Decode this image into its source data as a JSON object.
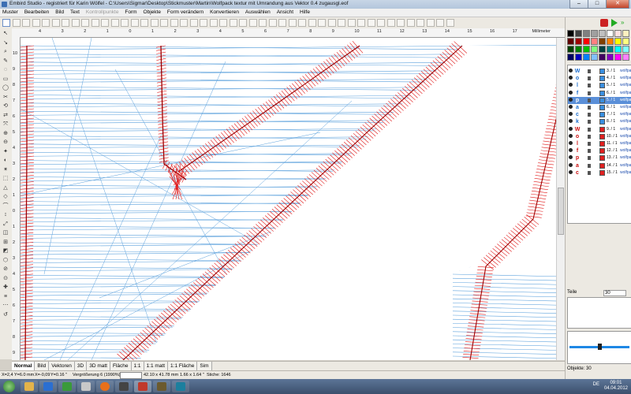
{
  "window": {
    "title": "Embird Studio - registriert für Karin Wölfel - C:\\Users\\Sigmar\\Desktop\\Stickmuster\\Martin\\Wolfpack textur mit Umrandung aus Vektor 0.4 zugausgl.eof",
    "minimize": "–",
    "maximize": "□",
    "close": "✕"
  },
  "menu": {
    "items": [
      "Muster",
      "Bearbeiten",
      "Bild",
      "Text",
      "Kontrollpunkte",
      "Form",
      "Objekte",
      "Form verändern",
      "Konvertieren",
      "Auswählen",
      "Ansicht",
      "Hilfe"
    ],
    "disabled_index": 4
  },
  "ruler": {
    "unit": "Millimeter",
    "h_labels": [
      "4",
      "3",
      "2",
      "1",
      "0",
      "1",
      "2",
      "3",
      "4",
      "5",
      "6",
      "7",
      "8",
      "9",
      "10",
      "11",
      "12",
      "13",
      "14",
      "15",
      "16",
      "17"
    ],
    "v_labels": [
      "10",
      "9",
      "8",
      "7",
      "6",
      "5",
      "4",
      "3",
      "2",
      "1",
      "0",
      "1",
      "2",
      "3",
      "4",
      "5",
      "6",
      "7",
      "8",
      "9"
    ]
  },
  "tabs": {
    "items": [
      "Normal",
      "Bild",
      "Vektoren",
      "3D",
      "3D matt",
      "Fläche",
      "1:1",
      "1:1 matt",
      "1:1 Fläche",
      "Sim"
    ],
    "active_index": 0
  },
  "status": {
    "x1": "X=2,4",
    "y1": "Y=6.0 mm",
    "x2": "X=-0,09",
    "y2": "Y=0.16 \"",
    "zoom": "Vergrößerung 6 (1990%)",
    "size_mm": "42.10 x 41.78 mm",
    "size_in": "1.66 x 1.64 \"",
    "stiche": "Stiche: 1646"
  },
  "right_panel": {
    "teile_label": "Teile",
    "teile_value": "30",
    "objekte": "Objekte: 30",
    "palette_colors": [
      "#000000",
      "#404040",
      "#808080",
      "#a0a0a0",
      "#c0c0c0",
      "#ffffff",
      "#ffe0e0",
      "#fff0c0",
      "#600000",
      "#a00000",
      "#ff0000",
      "#ff8080",
      "#804000",
      "#ff8000",
      "#ffff00",
      "#ffff80",
      "#004000",
      "#008000",
      "#00c000",
      "#80ff80",
      "#004040",
      "#008080",
      "#00ffff",
      "#80ffff",
      "#000060",
      "#0000c0",
      "#0080ff",
      "#80c0ff",
      "#400060",
      "#8000c0",
      "#ff00ff",
      "#ff80ff"
    ],
    "objects": [
      {
        "char": "W",
        "color": "#3a8fe0",
        "num": "3. / 1",
        "name": "wolfpack",
        "char_color": "#1e6fcf"
      },
      {
        "char": "o",
        "color": "#3a8fe0",
        "num": "4. / 1",
        "name": "wolfpack",
        "char_color": "#1e6fcf"
      },
      {
        "char": "l",
        "color": "#3a8fe0",
        "num": "5. / 1",
        "name": "wolfpack",
        "char_color": "#1e6fcf"
      },
      {
        "char": "f",
        "color": "#3a8fe0",
        "num": "6. / 1",
        "name": "wolfpack",
        "char_color": "#1e6fcf"
      },
      {
        "char": "p",
        "color": "#3a8fe0",
        "num": "5. / 1",
        "name": "wolfpack",
        "char_color": "#1e6fcf",
        "selected": true
      },
      {
        "char": "a",
        "color": "#3a8fe0",
        "num": "6. / 1",
        "name": "wolfpack",
        "char_color": "#1e6fcf"
      },
      {
        "char": "c",
        "color": "#3a8fe0",
        "num": "7. / 1",
        "name": "wolfpack",
        "char_color": "#1e6fcf"
      },
      {
        "char": "k",
        "color": "#3a8fe0",
        "num": "8. / 1",
        "name": "wolfpack",
        "char_color": "#1e6fcf"
      },
      {
        "char": "W",
        "color": "#e02020",
        "num": "9. / 1",
        "name": "wolfpack",
        "char_color": "#cc1010"
      },
      {
        "char": "o",
        "color": "#e02020",
        "num": "10. / 1",
        "name": "wolfpack",
        "char_color": "#cc1010"
      },
      {
        "char": "l",
        "color": "#e02020",
        "num": "11. / 1",
        "name": "wolfpack",
        "char_color": "#cc1010"
      },
      {
        "char": "f",
        "color": "#e02020",
        "num": "12. / 1",
        "name": "wolfpack",
        "char_color": "#cc1010"
      },
      {
        "char": "p",
        "color": "#e02020",
        "num": "13. / 1",
        "name": "wolfpack",
        "char_color": "#cc1010"
      },
      {
        "char": "a",
        "color": "#e02020",
        "num": "14. / 1",
        "name": "wolfpack",
        "char_color": "#cc1010"
      },
      {
        "char": "c",
        "color": "#e02020",
        "num": "15. / 1",
        "name": "wolfpack",
        "char_color": "#cc1010"
      }
    ]
  },
  "taskbar": {
    "lang": "DE",
    "time": "09:01",
    "date": "04.04.2012"
  },
  "colors": {
    "stitch_blue": "#5aa0dc",
    "stitch_red": "#e01818",
    "stitch_dark_red": "#a00000"
  }
}
